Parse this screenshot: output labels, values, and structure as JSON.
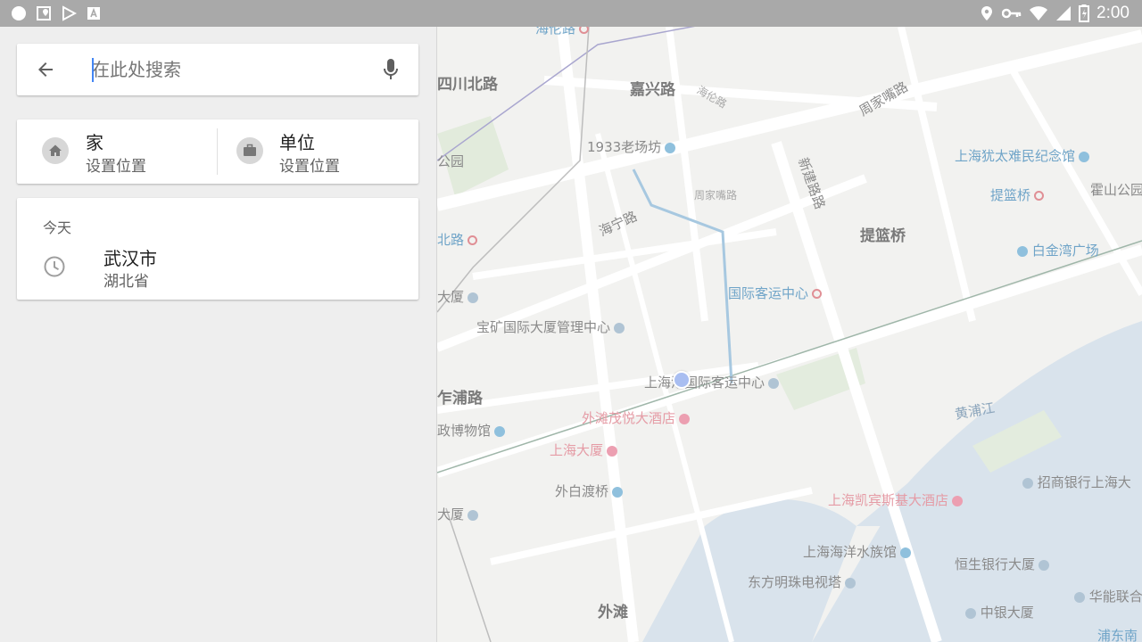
{
  "status_bar": {
    "time": "2:00",
    "left_icons": [
      "circle-icon",
      "maps-notification-icon",
      "play-store-icon",
      "text-a-icon"
    ],
    "right_icons": [
      "location-icon",
      "vpn-key-icon",
      "wifi-icon",
      "signal-icon",
      "battery-icon"
    ]
  },
  "search": {
    "placeholder": "在此处搜索",
    "value": ""
  },
  "places": {
    "home": {
      "title": "家",
      "subtitle": "设置位置"
    },
    "work": {
      "title": "单位",
      "subtitle": "设置位置"
    }
  },
  "history": {
    "section_label": "今天",
    "items": [
      {
        "title": "武汉市",
        "subtitle": "湖北省"
      }
    ]
  },
  "map": {
    "labels": {
      "hailun_road": "海伦路",
      "sichuan_north": "四川北路",
      "jiaxing_road": "嘉兴路",
      "hailun_road2": "海伦路",
      "zhoujiazui": "周家嘴路",
      "laochangfang": "1933老场坊",
      "park": "公园",
      "zhoujiazui2": "周家嘴路",
      "xinjianlu": "新建路路",
      "jewish_museum": "上海犹太难民纪念馆",
      "tilanqiao_station": "提篮桥",
      "huoshan_park": "霍山公园",
      "north_road": "北路",
      "haining_road": "海宁路",
      "tilanqiao": "提篮桥",
      "baijin_plaza": "白金湾广场",
      "intl_terminal_station": "国际客运中心",
      "building": "大厦",
      "baokuang": "宝矿国际大厦管理中心",
      "shanghai_terminal": "上海港国际客运中心",
      "zhapu_road": "乍浦路",
      "bund_hotel": "外滩茂悦大酒店",
      "huangpu_river": "黄浦江",
      "museum": "政博物馆",
      "shanghai_mansion": "上海大厦",
      "waibaidu": "外白渡桥",
      "cmb_bank": "招商银行上海大",
      "kempinski": "上海凯宾斯基大酒店",
      "building2": "大厦",
      "aquarium": "上海海洋水族馆",
      "hangseng": "恒生银行大厦",
      "pearl_tower": "东方明珠电视塔",
      "hualian": "华能联合",
      "the_bund": "外滩",
      "bank_of_china": "中银大厦",
      "pudong": "浦东南"
    }
  }
}
